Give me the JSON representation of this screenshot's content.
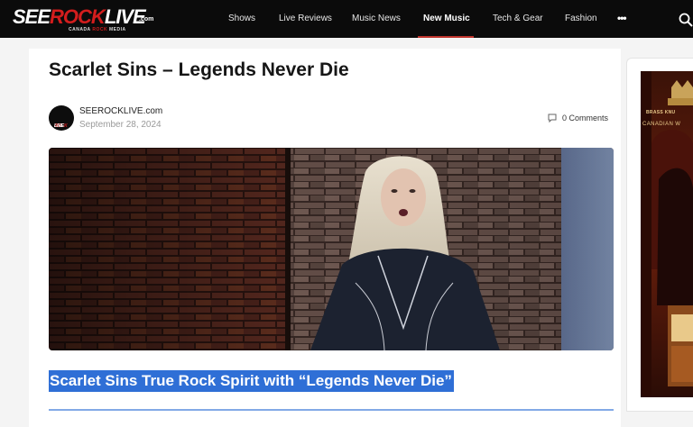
{
  "header": {
    "logo": {
      "main_white": "SEE",
      "main_red": "ROCK",
      "main_white2": "LIVE",
      "suffix": ".com",
      "tag_a": "CANADA",
      "tag_b": "ROCK",
      "tag_c": "MEDIA"
    },
    "nav": [
      {
        "label": "Shows"
      },
      {
        "label": "Live Reviews"
      },
      {
        "label": "Music News"
      },
      {
        "label": "New Music",
        "active": true
      },
      {
        "label": "Tech & Gear"
      },
      {
        "label": "Fashion"
      }
    ],
    "more_label": "•••",
    "accent": "#c0342c"
  },
  "article": {
    "title": "Scarlet Sins – Legends Never Die",
    "author": "SEEROCKLIVE.com",
    "date": "September 28, 2024",
    "comments": "0 Comments",
    "subtitle": "Scarlet Sins True Rock Spirit with “Legends Never Die”",
    "highlight": "#2f6fd6"
  },
  "avatar": {
    "white": "SEE",
    "red": "ROCK",
    "white2": "LIVE"
  },
  "sidebar_ad": {
    "brand": "BRASS KNU",
    "line": "CANADIAN W"
  }
}
